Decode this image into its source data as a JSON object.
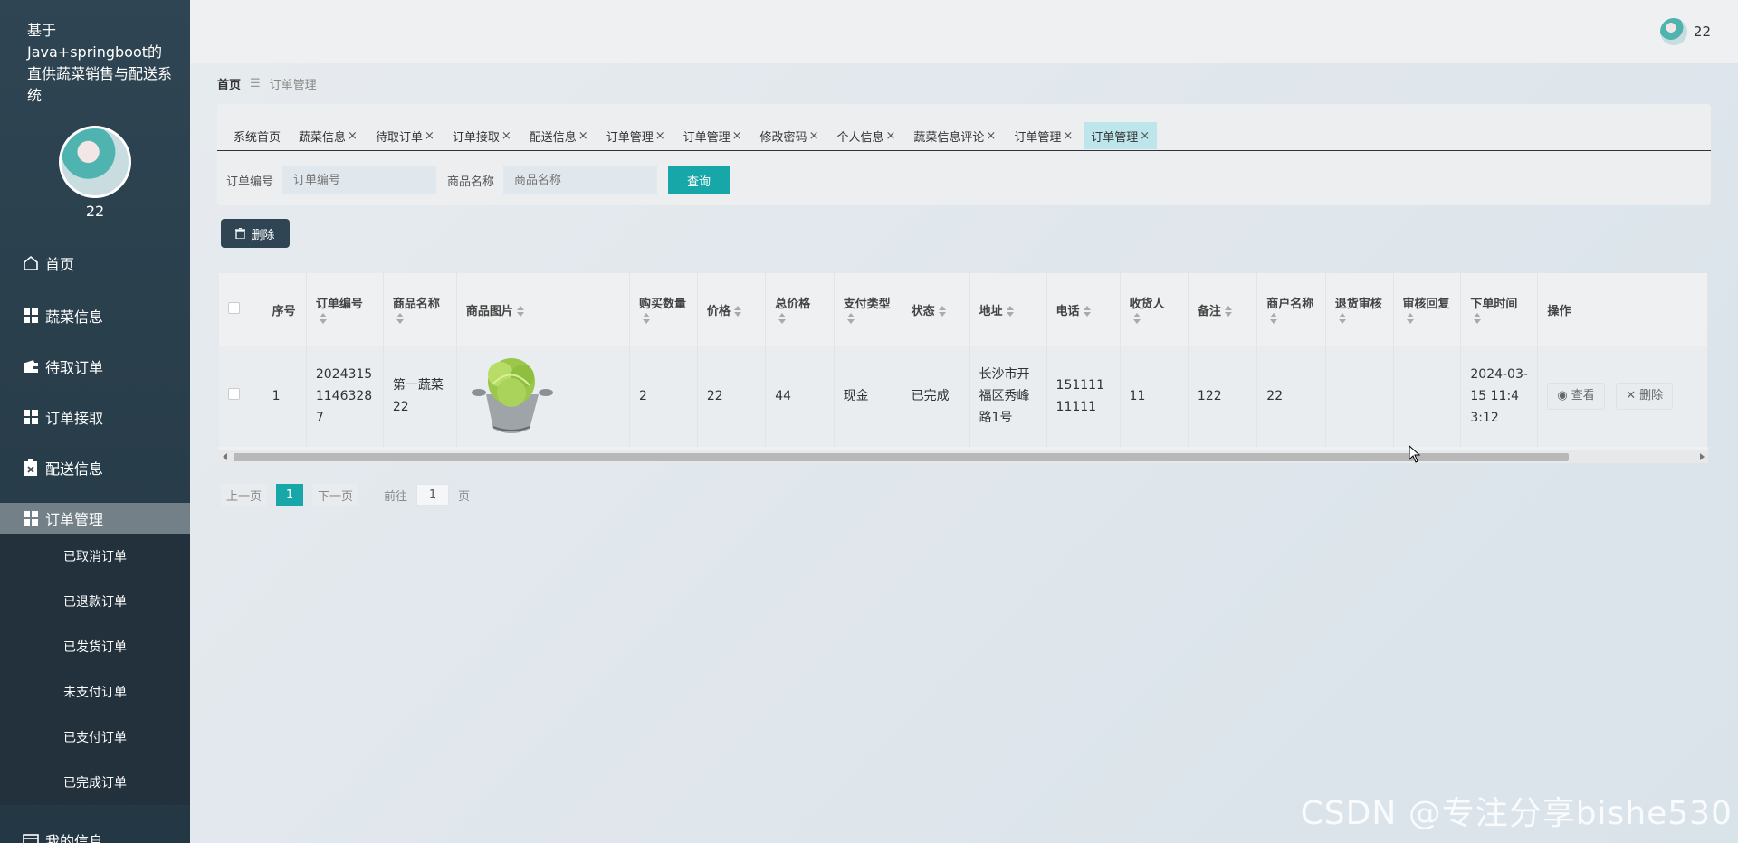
{
  "sidebar": {
    "system_title": "基于Java+springboot的直供蔬菜销售与配送系统",
    "username": "22",
    "menu": [
      {
        "label": "首页",
        "icon": "home-icon"
      },
      {
        "label": "蔬菜信息",
        "icon": "grid-icon"
      },
      {
        "label": "待取订单",
        "icon": "wallet-icon"
      },
      {
        "label": "订单接取",
        "icon": "grid-icon"
      },
      {
        "label": "配送信息",
        "icon": "clipboard-icon"
      },
      {
        "label": "订单管理",
        "icon": "grid-icon"
      }
    ],
    "submenu": [
      "已取消订单",
      "已退款订单",
      "已发货订单",
      "未支付订单",
      "已支付订单",
      "已完成订单"
    ],
    "partial_item": "我的信息"
  },
  "topbar": {
    "username": "22"
  },
  "breadcrumb": {
    "home": "首页",
    "current": "订单管理"
  },
  "tabs": [
    {
      "label": "系统首页",
      "closable": false
    },
    {
      "label": "蔬菜信息",
      "closable": true
    },
    {
      "label": "待取订单",
      "closable": true
    },
    {
      "label": "订单接取",
      "closable": true
    },
    {
      "label": "配送信息",
      "closable": true
    },
    {
      "label": "订单管理",
      "closable": true
    },
    {
      "label": "订单管理",
      "closable": true
    },
    {
      "label": "修改密码",
      "closable": true
    },
    {
      "label": "个人信息",
      "closable": true
    },
    {
      "label": "蔬菜信息评论",
      "closable": true
    },
    {
      "label": "订单管理",
      "closable": true
    },
    {
      "label": "订单管理",
      "closable": true,
      "active": true
    }
  ],
  "search": {
    "order_no_label": "订单编号",
    "order_no_placeholder": "订单编号",
    "product_name_label": "商品名称",
    "product_name_placeholder": "商品名称",
    "query_label": "查询"
  },
  "toolbar": {
    "delete_label": "删除"
  },
  "table": {
    "columns": [
      {
        "label": "序号",
        "sortable": false
      },
      {
        "label": "订单编号",
        "sortable": true
      },
      {
        "label": "商品名称",
        "sortable": true
      },
      {
        "label": "商品图片",
        "sortable": true
      },
      {
        "label": "购买数量",
        "sortable": true
      },
      {
        "label": "价格",
        "sortable": true
      },
      {
        "label": "总价格",
        "sortable": true
      },
      {
        "label": "支付类型",
        "sortable": true
      },
      {
        "label": "状态",
        "sortable": true
      },
      {
        "label": "地址",
        "sortable": true
      },
      {
        "label": "电话",
        "sortable": true
      },
      {
        "label": "收货人",
        "sortable": true
      },
      {
        "label": "备注",
        "sortable": true
      },
      {
        "label": "商户名称",
        "sortable": true
      },
      {
        "label": "退货审核",
        "sortable": true
      },
      {
        "label": "审核回复",
        "sortable": true
      },
      {
        "label": "下单时间",
        "sortable": true
      },
      {
        "label": "操作",
        "sortable": false
      }
    ],
    "rows": [
      {
        "index": "1",
        "order_no": "20243151146328 7",
        "product_name": "第一蔬菜22",
        "quantity": "2",
        "price": "22",
        "total": "44",
        "pay_type": "现金",
        "status": "已完成",
        "address": "长沙市开福区秀峰路1号",
        "phone": "15111111111",
        "receiver": "11",
        "remark": "122",
        "merchant": "22",
        "return_review": "",
        "review_reply": "",
        "order_time": "2024-03-15 11:43:12",
        "view_label": "查看",
        "delete_label": "删除"
      }
    ]
  },
  "pagination": {
    "prev": "上一页",
    "current": "1",
    "next": "下一页",
    "goto_prefix": "前往",
    "goto_value": "1",
    "goto_suffix": "页"
  },
  "watermark": "CSDN @专注分享bishe530",
  "colors": {
    "sidebar": "#2f4553",
    "accent": "#17a7a8",
    "active_tab": "#bde6ec"
  }
}
